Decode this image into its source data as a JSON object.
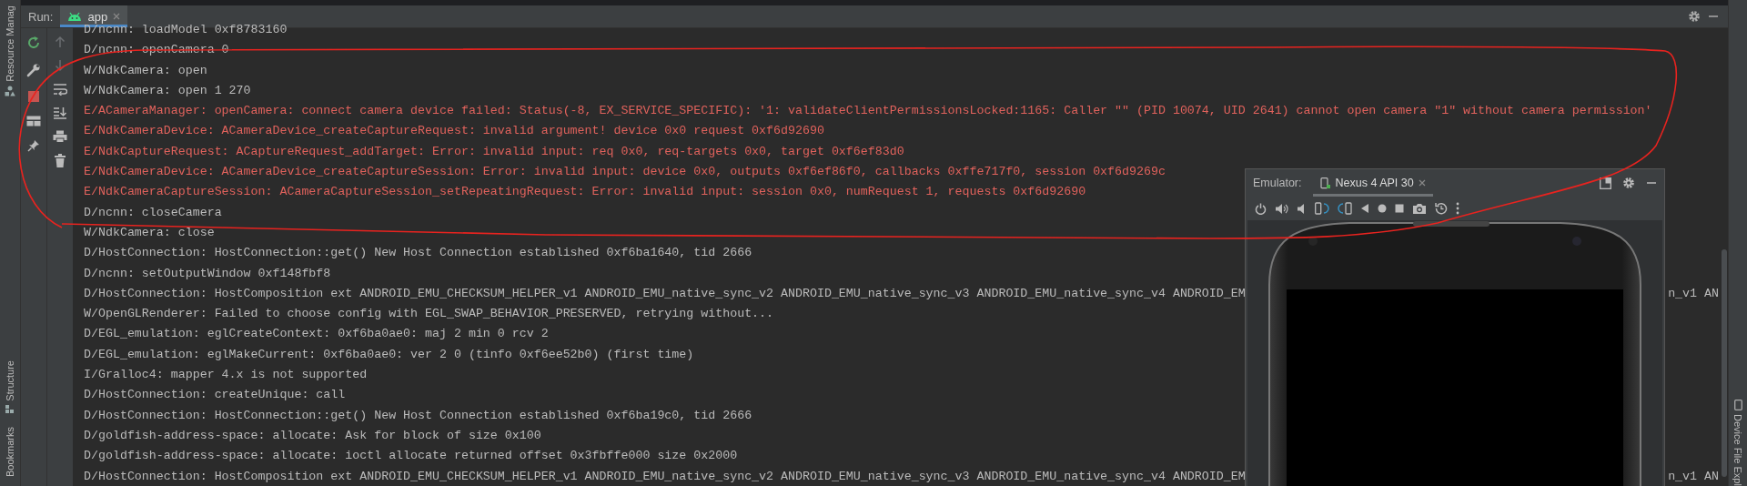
{
  "side_left": {
    "labels": [
      "Resource Manag",
      "Structure",
      "Bookmarks"
    ]
  },
  "run_bar": {
    "label": "Run:",
    "tabs": [
      {
        "label": "app",
        "selected": true
      }
    ]
  },
  "log": {
    "lines": [
      {
        "kind": "plain",
        "text": "D/ncnn: loadModel 0xf8783160"
      },
      {
        "kind": "plain",
        "text": "D/ncnn: openCamera 0"
      },
      {
        "kind": "plain",
        "text": "W/NdkCamera: open"
      },
      {
        "kind": "plain",
        "text": "W/NdkCamera: open 1 270"
      },
      {
        "kind": "error",
        "text": "E/ACameraManager: openCamera: connect camera device failed: Status(-8, EX_SERVICE_SPECIFIC): '1: validateClientPermissionsLocked:1165: Caller \"\" (PID 10074, UID 2641) cannot open camera \"1\" without camera permission'"
      },
      {
        "kind": "error",
        "text": "E/NdkCameraDevice: ACameraDevice_createCaptureRequest: invalid argument! device 0x0 request 0xf6d92690"
      },
      {
        "kind": "error",
        "text": "E/NdkCaptureRequest: ACaptureRequest_addTarget: Error: invalid input: req 0x0, req-targets 0x0, target 0xf6ef83d0"
      },
      {
        "kind": "error",
        "text": "E/NdkCameraDevice: ACameraDevice_createCaptureSession: Error: invalid input: device 0x0, outputs 0xf6ef86f0, callbacks 0xffe717f0, session 0xf6d9269c"
      },
      {
        "kind": "error",
        "text": "E/NdkCameraCaptureSession: ACameraCaptureSession_setRepeatingRequest: Error: invalid input: session 0x0, numRequest 1, requests 0xf6d92690"
      },
      {
        "kind": "plain",
        "text": "D/ncnn: closeCamera"
      },
      {
        "kind": "plain",
        "text": "W/NdkCamera: close"
      },
      {
        "kind": "plain",
        "text": "D/HostConnection: HostConnection::get() New Host Connection established 0xf6ba1640, tid 2666"
      },
      {
        "kind": "plain",
        "text": "D/ncnn: setOutputWindow 0xf148fbf8"
      },
      {
        "kind": "plain",
        "text": "D/HostConnection: HostComposition ext ANDROID_EMU_CHECKSUM_HELPER_v1 ANDROID_EMU_native_sync_v2 ANDROID_EMU_native_sync_v3 ANDROID_EMU_native_sync_v4 ANDROID_EM",
        "tail": "n_v1 AN"
      },
      {
        "kind": "plain",
        "text": "W/OpenGLRenderer: Failed to choose config with EGL_SWAP_BEHAVIOR_PRESERVED, retrying without..."
      },
      {
        "kind": "plain",
        "text": "D/EGL_emulation: eglCreateContext: 0xf6ba0ae0: maj 2 min 0 rcv 2"
      },
      {
        "kind": "plain",
        "text": "D/EGL_emulation: eglMakeCurrent: 0xf6ba0ae0: ver 2 0 (tinfo 0xf6ee52b0) (first time)"
      },
      {
        "kind": "plain",
        "text": "I/Gralloc4: mapper 4.x is not supported"
      },
      {
        "kind": "plain",
        "text": "D/HostConnection: createUnique: call"
      },
      {
        "kind": "plain",
        "text": "D/HostConnection: HostConnection::get() New Host Connection established 0xf6ba19c0, tid 2666"
      },
      {
        "kind": "plain",
        "text": "D/goldfish-address-space: allocate: Ask for block of size 0x100"
      },
      {
        "kind": "plain",
        "text": "D/goldfish-address-space: allocate: ioctl allocate returned offset 0x3fbffe000 size 0x2000"
      },
      {
        "kind": "plain",
        "text": "D/HostConnection: HostComposition ext ANDROID_EMU_CHECKSUM_HELPER_v1 ANDROID_EMU_native_sync_v2 ANDROID_EMU_native_sync_v3 ANDROID_EMU_native_sync_v4 ANDROID_EM",
        "tail": "n_v1 AN"
      }
    ]
  },
  "emulator": {
    "label": "Emulator:",
    "tabs": [
      {
        "label": "Nexus 4 API 30",
        "selected": true
      }
    ]
  },
  "side_right": {
    "labels": [
      "Device File Expl"
    ]
  }
}
